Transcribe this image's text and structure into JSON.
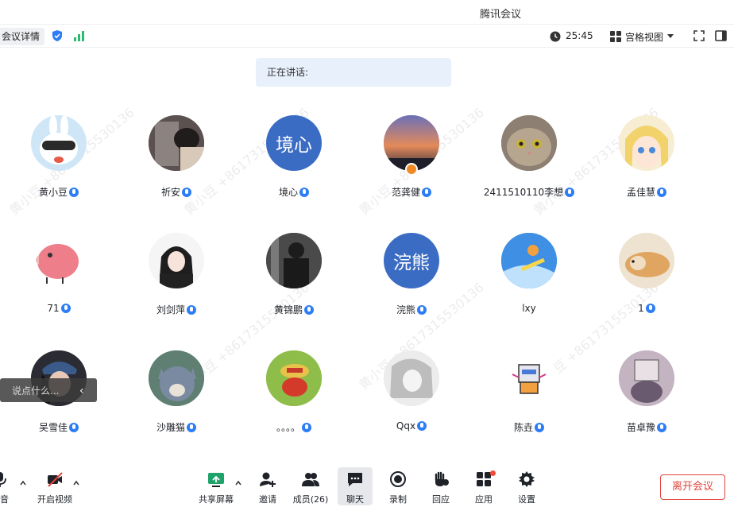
{
  "window": {
    "title": "腾讯会议"
  },
  "infobar": {
    "details_label": "会议详情",
    "timer": "25:45",
    "view_label": "宫格视图"
  },
  "speaking_label": "正在讲话:",
  "participants": [
    {
      "name": "黄小豆"
    },
    {
      "name": "祈安"
    },
    {
      "name": "境心",
      "avatar_text": "境心"
    },
    {
      "name": "范龚健"
    },
    {
      "name": "2411510110李想"
    },
    {
      "name": "孟佳慧"
    },
    {
      "name": "71"
    },
    {
      "name": "刘剑萍"
    },
    {
      "name": "黄锦鹏"
    },
    {
      "name": "浣熊",
      "avatar_text": "浣熊"
    },
    {
      "name": "lxy"
    },
    {
      "name": "1"
    },
    {
      "name": "吴雪佳"
    },
    {
      "name": "沙雕猫"
    },
    {
      "name": "。。。。"
    },
    {
      "name": "Qqx"
    },
    {
      "name": "陈垚"
    },
    {
      "name": "苗卓豫"
    }
  ],
  "watermark_text": "黄小豆 +8617315530136",
  "chat_popup": {
    "hint": "说点什么..."
  },
  "toolbar": {
    "mute_label": "静音",
    "video_label": "开启视频",
    "share_label": "共享屏幕",
    "invite_label": "邀请",
    "members_label": "成员(26)",
    "chat_label": "聊天",
    "record_label": "录制",
    "react_label": "回应",
    "apps_label": "应用",
    "settings_label": "设置",
    "leave_label": "离开会议"
  },
  "colors": {
    "accent": "#2d7df6",
    "leave": "#e1443a",
    "text_avatar": "#3b6cc4",
    "host_badge": "#f08a24"
  }
}
